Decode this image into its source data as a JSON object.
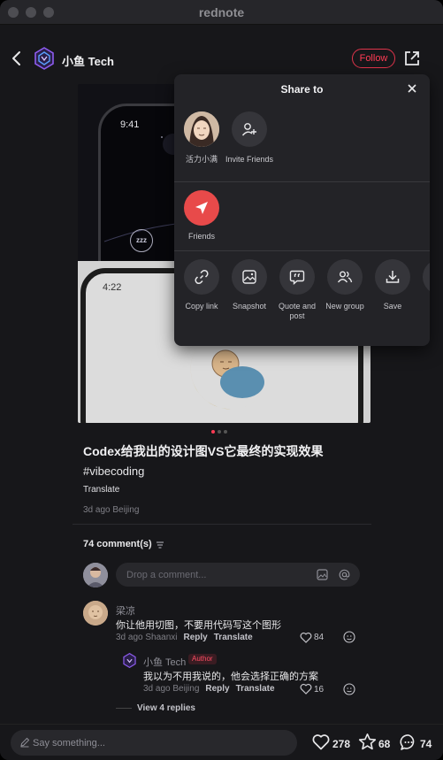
{
  "window": {
    "title": "rednote"
  },
  "header": {
    "author_name": "小鱼 Tech",
    "follow_label": "Follow"
  },
  "post": {
    "phone1_time": "9:41",
    "phone2_time": "4:22",
    "zzz_label": "zzz",
    "title": "Codex给我出的设计图VS它最终的实现效果",
    "hashtag": "#vibecoding",
    "translate_label": "Translate",
    "meta": "3d ago Beijing",
    "carousel": {
      "pages": 3,
      "current": 1
    }
  },
  "comments": {
    "count_label": "74 comment(s)",
    "input_placeholder": "Drop a comment...",
    "items": [
      {
        "name": "梁凉",
        "text": "你让他用切图，不要用代码写这个图形",
        "time_location": "3d ago Shaanxi",
        "reply_label": "Reply",
        "translate_label": "Translate",
        "likes": "84",
        "replies": [
          {
            "name": "小鱼 Tech",
            "badge": "Author",
            "text": "我以为不用我说的，他会选择正确的方案",
            "time_location": "3d ago Beijing",
            "reply_label": "Reply",
            "translate_label": "Translate",
            "likes": "16"
          }
        ],
        "view_replies_label": "View 4 replies"
      }
    ]
  },
  "bottom_bar": {
    "placeholder": "Say something...",
    "likes": "278",
    "collects": "68",
    "comments": "74"
  },
  "share": {
    "title": "Share to",
    "contacts": [
      {
        "name": "活力小满"
      },
      {
        "name": "Invite Friends",
        "icon": "person-add-icon"
      }
    ],
    "apps": [
      {
        "name": "Friends",
        "icon": "send-icon",
        "color": "#e84a4a"
      }
    ],
    "actions": [
      {
        "label": "Copy link",
        "icon": "link-icon"
      },
      {
        "label": "Snapshot",
        "icon": "image-icon"
      },
      {
        "label": "Quote and post",
        "icon": "quote-icon"
      },
      {
        "label": "New group",
        "icon": "group-icon"
      },
      {
        "label": "Save",
        "icon": "download-icon"
      }
    ]
  },
  "colors": {
    "accent": "#ff3b54",
    "background": "#17171a",
    "panel": "#232327"
  }
}
